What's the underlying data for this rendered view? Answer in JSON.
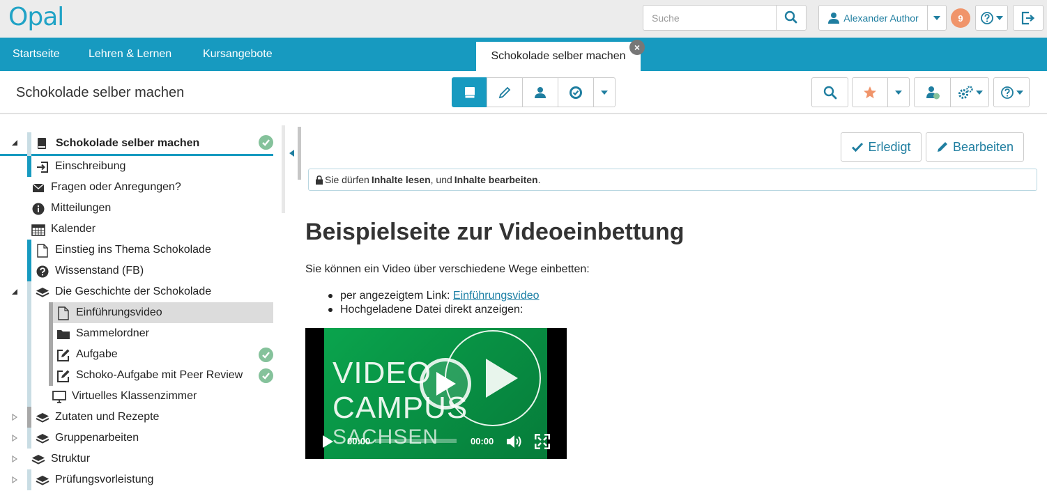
{
  "app": {
    "logo_text": "Opal"
  },
  "topbar": {
    "search_placeholder": "Suche",
    "user_name": "Alexander Author",
    "notifications_count": "9"
  },
  "nav": {
    "links": [
      "Startseite",
      "Lehren & Lernen",
      "Kursangebote"
    ],
    "active_tab": "Schokolade selber machen"
  },
  "course": {
    "title": "Schokolade selber machen"
  },
  "tree": [
    {
      "label": "Schokolade selber machen",
      "icon": "book-icon",
      "bold": true,
      "done": true,
      "toggle": "expanded"
    },
    {
      "label": "Einschreibung",
      "icon": "sign-in-icon"
    },
    {
      "label": "Fragen oder Anregungen?",
      "icon": "envelope-icon"
    },
    {
      "label": "Mitteilungen",
      "icon": "info-icon"
    },
    {
      "label": "Kalender",
      "icon": "calendar-icon"
    },
    {
      "label": "Einstieg ins Thema Schokolade",
      "icon": "page-icon"
    },
    {
      "label": "Wissenstand (FB)",
      "icon": "question-icon"
    },
    {
      "label": "Die Geschichte der Schokolade",
      "icon": "layers-icon",
      "toggle": "expanded"
    },
    {
      "label": "Einführungsvideo",
      "icon": "page-icon",
      "selected": true
    },
    {
      "label": "Sammelordner",
      "icon": "folder-icon"
    },
    {
      "label": "Aufgabe",
      "icon": "edit-icon",
      "done": true
    },
    {
      "label": "Schoko-Aufgabe mit Peer Review",
      "icon": "edit-icon",
      "done": true
    },
    {
      "label": "Virtuelles Klassenzimmer",
      "icon": "monitor-icon"
    },
    {
      "label": "Zutaten und Rezepte",
      "icon": "layers-icon",
      "toggle": "collapsed"
    },
    {
      "label": "Gruppenarbeiten",
      "icon": "layers-icon",
      "toggle": "collapsed"
    },
    {
      "label": "Struktur",
      "icon": "layers-icon",
      "toggle": "collapsed"
    },
    {
      "label": "Prüfungsvorleistung",
      "icon": "layers-icon",
      "toggle": "collapsed"
    }
  ],
  "actions": {
    "done_label": "Erledigt",
    "edit_label": "Bearbeiten"
  },
  "permission": {
    "prefix": "Sie dürfen",
    "read": "Inhalte lesen",
    "separator": ", und",
    "edit": "Inhalte bearbeiten",
    "suffix": "."
  },
  "content": {
    "title": "Beispielseite zur Videoeinbettung",
    "intro": "Sie können ein Video über verschiedene Wege einbetten:",
    "item1_prefix": "per angezeigtem Link:",
    "item1_link": "Einführungsvideo",
    "item2": "Hochgeladene Datei direkt anzeigen:"
  },
  "video": {
    "logo_line1": "VIDEO",
    "logo_line2": "CAMPUS",
    "logo_line3": "SACHSEN",
    "current_time": "00:00",
    "duration": "00:00",
    "progress": 0
  },
  "colors": {
    "brand": "#179ac0",
    "done_green": "#85c29b",
    "badge": "#f0946a",
    "link": "#1b7fa5"
  }
}
